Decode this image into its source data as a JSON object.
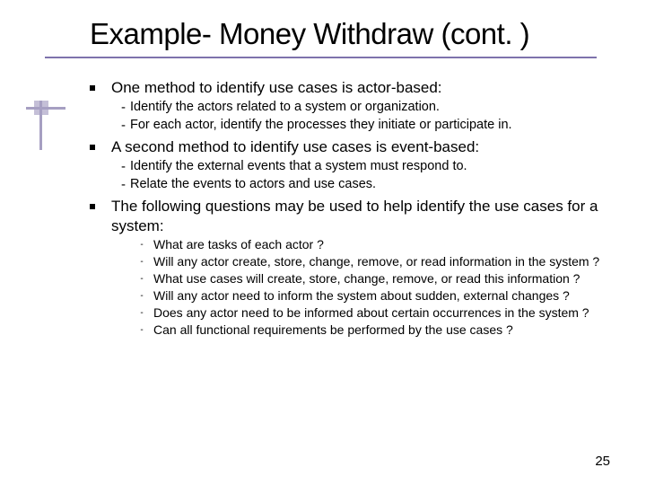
{
  "title": "Example- Money Withdraw (cont. )",
  "bullets": {
    "b1": "One method to identify use cases is actor-based:",
    "b1s1": "Identify the actors related to a system or organization.",
    "b1s2": "For each actor, identify the processes they initiate or participate in.",
    "b2": "A second method to identify use cases is event-based:",
    "b2s1": "Identify the external events that a system must respond to.",
    "b2s2": "Relate the events to actors and use cases.",
    "b3": "The following questions may be used to help identify the use cases for a system:",
    "b3s1": "What are tasks of each actor ?",
    "b3s2": "Will any actor create, store, change, remove, or read information in the system ?",
    "b3s3": "What use cases will create, store, change, remove, or read this information ?",
    "b3s4": "Will any actor need to inform the system about sudden, external changes ?",
    "b3s5": "Does any actor need to be informed about certain occurrences in the system ?",
    "b3s6": "Can all functional requirements be performed by the use cases ?"
  },
  "page_number": "25"
}
